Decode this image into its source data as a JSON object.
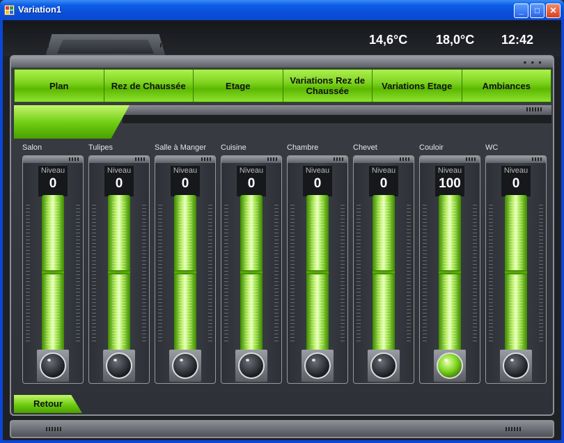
{
  "window": {
    "title": "Variation1",
    "controls": {
      "minimize": "_",
      "maximize": "□",
      "close": "✕"
    }
  },
  "header": {
    "temp_outdoor": "14,6°C",
    "temp_indoor": "18,0°C",
    "clock": "12:42"
  },
  "menu": {
    "items": [
      {
        "label": "Plan"
      },
      {
        "label": "Rez de Chaussée"
      },
      {
        "label": "Etage"
      },
      {
        "label": "Variations Rez de Chaussée"
      },
      {
        "label": "Variations Etage"
      },
      {
        "label": "Ambiances"
      }
    ]
  },
  "sliders": {
    "niveau_label": "Niveau",
    "items": [
      {
        "room": "Salon",
        "value": "0",
        "active": false
      },
      {
        "room": "Tulipes",
        "value": "0",
        "active": false
      },
      {
        "room": "Salle à Manger",
        "value": "0",
        "active": false
      },
      {
        "room": "Cuisine",
        "value": "0",
        "active": false
      },
      {
        "room": "Chambre",
        "value": "0",
        "active": false
      },
      {
        "room": "Chevet",
        "value": "0",
        "active": false
      },
      {
        "room": "Couloir",
        "value": "100",
        "active": true
      },
      {
        "room": "WC",
        "value": "0",
        "active": false
      }
    ]
  },
  "footer": {
    "back_label": "Retour"
  },
  "colors": {
    "accent_green": "#7ed420",
    "panel_dark": "#2e3137"
  }
}
